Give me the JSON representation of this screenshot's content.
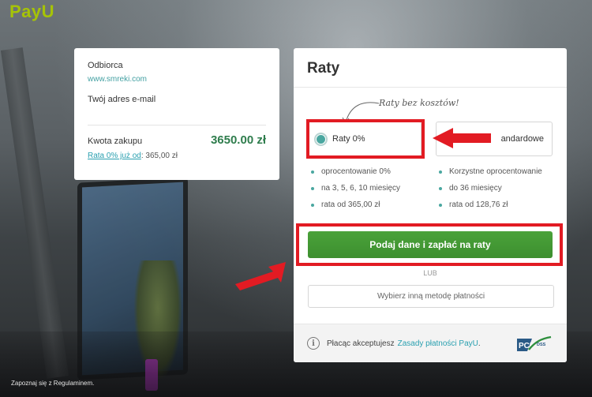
{
  "brand": {
    "logo_text": "PayU",
    "logo_color": "#a6c307"
  },
  "summary": {
    "recipient_label": "Odbiorca",
    "recipient_url": "www.smreki.com",
    "email_label": "Twój adres e-mail",
    "amount_label": "Kwota zakupu",
    "amount_value": "3650.00 zł",
    "installment_link_text": "Rata 0% już od",
    "installment_value": ": 365,00 zł"
  },
  "raty": {
    "title": "Raty",
    "hint": "Raty bez kosztów!",
    "option_a": {
      "label": "Raty 0%",
      "selected": true,
      "features": [
        "oprocentowanie 0%",
        "na 3, 5, 6, 10 miesięcy",
        "rata od 365,00 zł"
      ]
    },
    "option_b": {
      "label": "andardowe",
      "features": [
        "Korzystne oprocentowanie",
        "do 36 miesięcy",
        "rata od 128,76 zł"
      ]
    },
    "pay_button": "Podaj dane i zapłać na raty",
    "or_text": "LUB",
    "other_method_button": "Wybierz inną metodę płatności",
    "footer_text": "Płacąc akceptujesz",
    "footer_link": "Zasady płatności PayU",
    "footer_period": ".",
    "pci_text": "PCI",
    "pci_sub": "DSS"
  },
  "bottom": {
    "line1": "Zapoznaj się z Regulaminem."
  },
  "colors": {
    "accent_teal": "#4aa7a0",
    "amount_green": "#2f7d4d",
    "pay_button_green": "#3d8f2f",
    "highlight_red": "#e21b23"
  }
}
